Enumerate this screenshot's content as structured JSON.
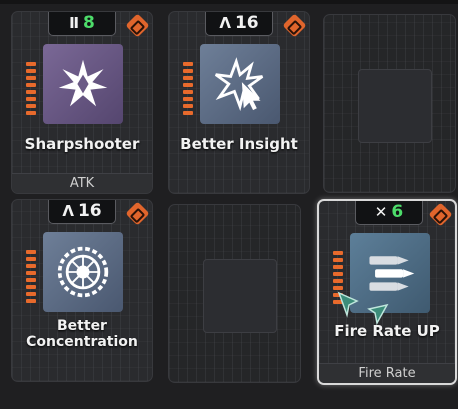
{
  "cards": [
    {
      "name": "Sharpshooter",
      "level_icon": "rank-bars-icon",
      "level_glyph": "Ⅱ",
      "level": "8",
      "level_color": "#4ddc6a",
      "footer": "ATK",
      "icon": "shatter-star-icon",
      "icon_bg": "#6b5a86"
    },
    {
      "name": "Better Insight",
      "level_icon": "chevron-up-icon",
      "level_glyph": "Λ",
      "level": "16",
      "level_color": "#f2f2f2",
      "footer": "",
      "icon": "burst-cursor-icon",
      "icon_bg": "#5f6e86"
    },
    {
      "name": "Better Concentration",
      "level_icon": "chevron-up-icon",
      "level_glyph": "Λ",
      "level": "16",
      "level_color": "#f2f2f2",
      "footer": "",
      "icon": "circular-gear-icon",
      "icon_bg": "#5f6e86"
    },
    {
      "name": "Fire Rate UP",
      "level_icon": "crossed-arrows-icon",
      "level_glyph": "✕",
      "level": "6",
      "level_color": "#4ddc6a",
      "footer": "Fire Rate",
      "icon": "bullets-icon",
      "icon_bg": "#4f6f88"
    }
  ],
  "colors": {
    "accent_orange": "#e86a2c",
    "level_green": "#4ddc6a",
    "selected_border": "#d9d9d9"
  }
}
